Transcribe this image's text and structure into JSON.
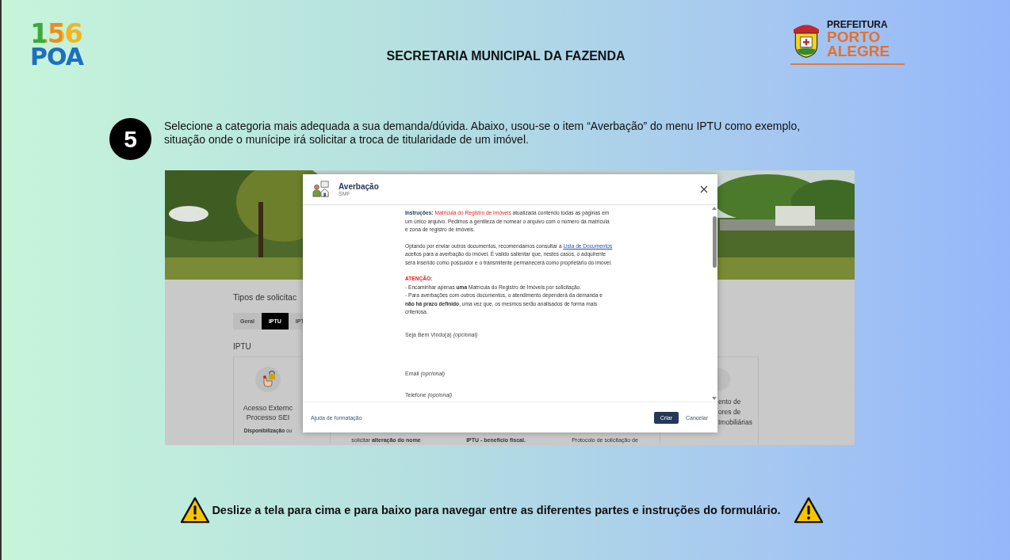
{
  "header": {
    "logo_number": "156",
    "logo_city": "POA",
    "title": "SECRETARIA MUNICIPAL DA FAZENDA",
    "org_line1": "PREFEITURA",
    "org_line2": "PORTO",
    "org_line3": "ALEGRE"
  },
  "step": {
    "number": "5",
    "text": "Selecione a categoria mais adequada a sua demanda/dúvida. Abaixo, usou-se o item “Averbação” do menu IPTU como exemplo, situação onde o munícipe irá solicitar a troca de titularidade de um imóvel."
  },
  "screenshot": {
    "page": {
      "section_title": "Tipos de solicitac",
      "tabs": [
        {
          "label": "Geral",
          "selected": false
        },
        {
          "label": "IPTU",
          "selected": true
        },
        {
          "label": "IPT",
          "selected": false
        }
      ],
      "category_title": "IPTU",
      "cards": [
        {
          "kind": "left",
          "lines": [
            "Acesso Externc",
            "Processo SEI"
          ],
          "description": "**Disponibilização** ou"
        },
        {
          "kind": "bottom",
          "description": "solicitar **alteração do nome**"
        },
        {
          "kind": "bottom",
          "description": "**IPTU - benefício fiscal.**"
        },
        {
          "kind": "bottom",
          "description": "Protocolo de solicitação de"
        },
        {
          "kind": "right",
          "lines": [
            "ento de",
            "ores de",
            "Imobiliárias"
          ]
        }
      ]
    },
    "dialog": {
      "title": "Averbação",
      "subtitle": "SMF",
      "instructions": {
        "label": "Instruções:",
        "highlight": "Matrícula do Registro de Imóveis",
        "text": "atualizada contendo todas as páginas em um único arquivo. Pedimos a gentileza de nomear o arquivo com o número da matrícula e zona de registro de imóveis."
      },
      "note": {
        "before": "Optando por enviar outros documentos, recomendamos consultar a",
        "link": "Lista de Documentos",
        "after": "aceitos para a averbação do imóvel. É valido salientar que, nestes casos, o adquirente será inserido como possuidor e o transmitente permanecerá como proprietário do imóvel."
      },
      "attention": {
        "heading": "ATENÇÃO:",
        "items": [
          "- Encaminhar apenas **uma** Matrícula do Registro de Imóveis por solicitação.",
          "- Para averbações com outros documentos, o atendimento dependerá da demanda e **não há prazo definido**, uma vez que, os mesmos serão analisados de forma mais criteriosa."
        ]
      },
      "fields": [
        {
          "kind": "multiline",
          "label": "Seja Bem Vindo(a) *(opcional)*"
        },
        {
          "kind": "line",
          "label": "Email *(opcional)*"
        },
        {
          "kind": "line",
          "label": "Telefone *(opcional)*"
        }
      ],
      "help_link": "Ajuda de formatação",
      "primary_button": "Criar",
      "secondary_button": "Cancelar"
    }
  },
  "warning": "Deslize a tela para cima e para baixo para navegar entre as diferentes partes e instruções do formulário."
}
